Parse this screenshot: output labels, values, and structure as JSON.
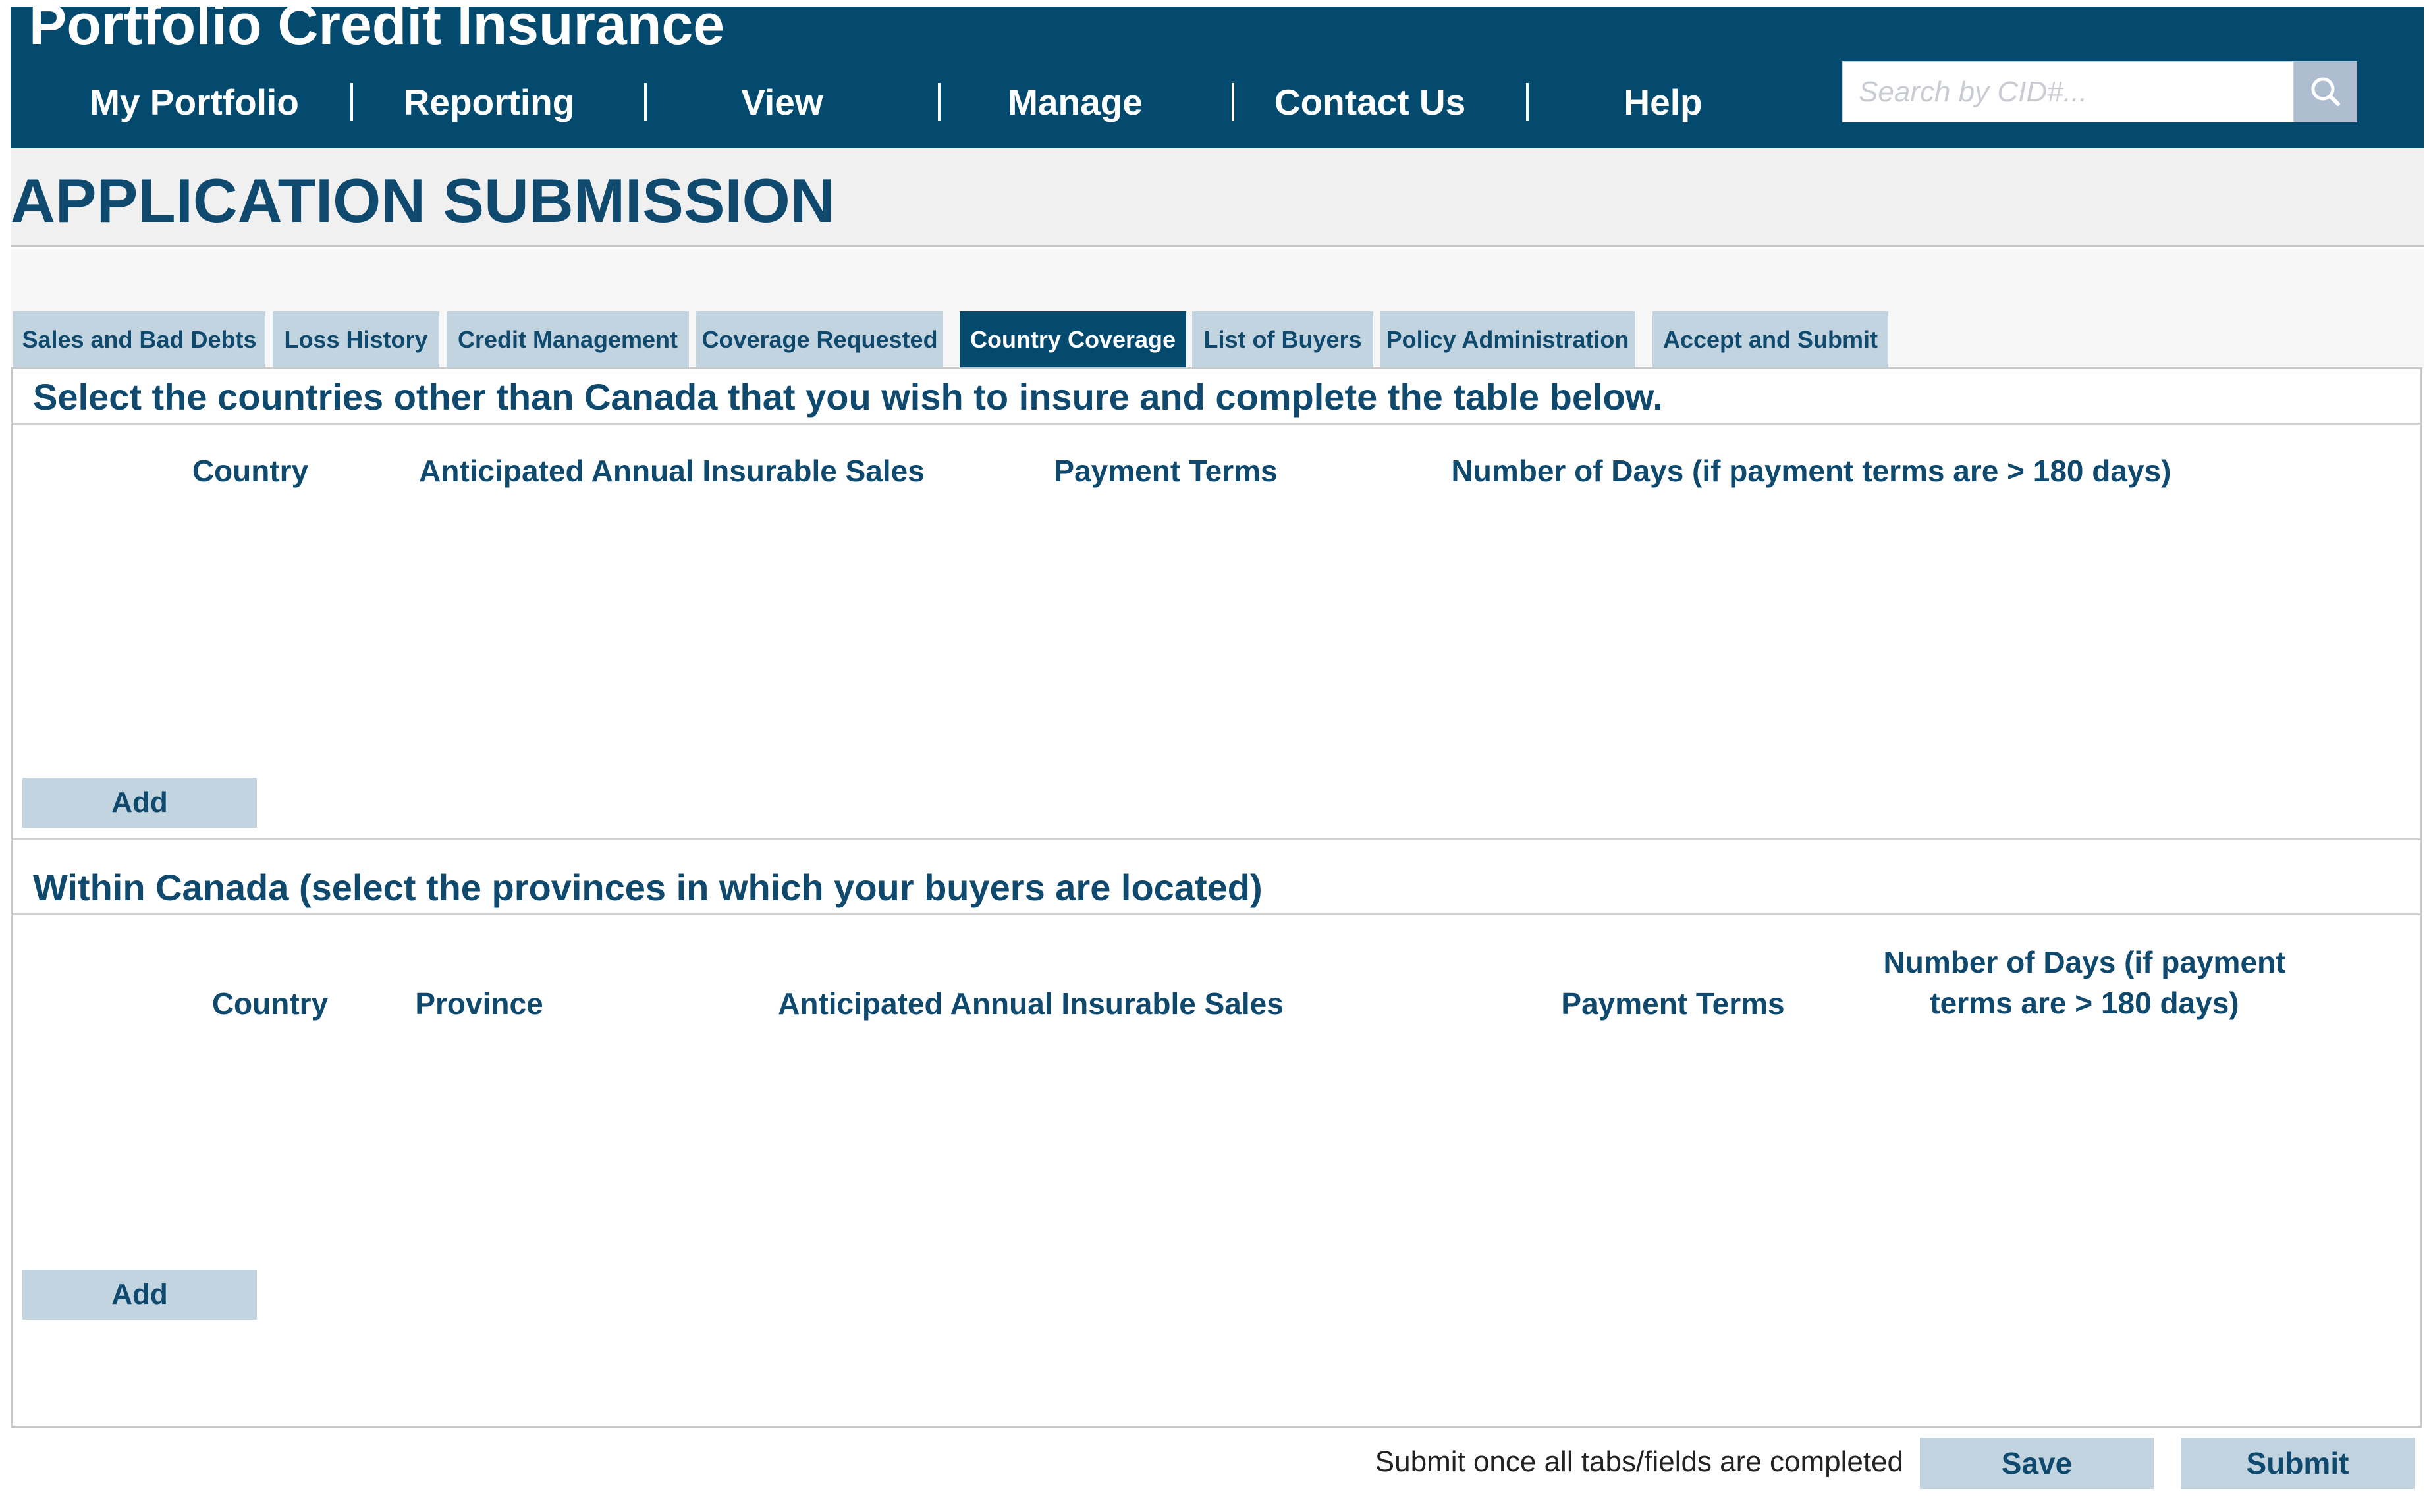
{
  "header": {
    "title": "Portfolio Credit Insurance",
    "nav": [
      "My Portfolio",
      "Reporting",
      "View",
      "Manage",
      "Contact Us",
      "Help"
    ],
    "search_placeholder": "Search by CID#...",
    "search_icon": "magnifier-icon"
  },
  "page": {
    "title": "APPLICATION SUBMISSION"
  },
  "tabs": [
    {
      "label": "Sales and Bad Debts",
      "active": false
    },
    {
      "label": "Loss History",
      "active": false
    },
    {
      "label": "Credit Management",
      "active": false
    },
    {
      "label": "Coverage Requested",
      "active": false
    },
    {
      "label": "Country Coverage",
      "active": true
    },
    {
      "label": "List of Buyers",
      "active": false
    },
    {
      "label": "Policy Administration",
      "active": false
    },
    {
      "label": "Accept and Submit",
      "active": false
    }
  ],
  "foreign_section": {
    "title": "Select the countries other than Canada that you wish to insure and complete the table below.",
    "columns": [
      "Country",
      "Anticipated Annual Insurable Sales",
      "Payment Terms",
      "Number of Days (if payment terms are > 180 days)"
    ],
    "add_label": "Add"
  },
  "canada_section": {
    "title": "Within Canada (select the provinces in which your buyers are located)",
    "columns": [
      "Country",
      "Province",
      "Anticipated Annual Insurable Sales",
      "Payment Terms",
      "Number of Days (if payment terms are > 180 days)"
    ],
    "add_label": "Add"
  },
  "footer": {
    "note": "Submit once all tabs/fields are completed",
    "save_label": "Save",
    "submit_label": "Submit"
  },
  "colors": {
    "brand": "#034a6e",
    "button_bg": "#c2d4e0",
    "text": "#0f4a6e"
  }
}
